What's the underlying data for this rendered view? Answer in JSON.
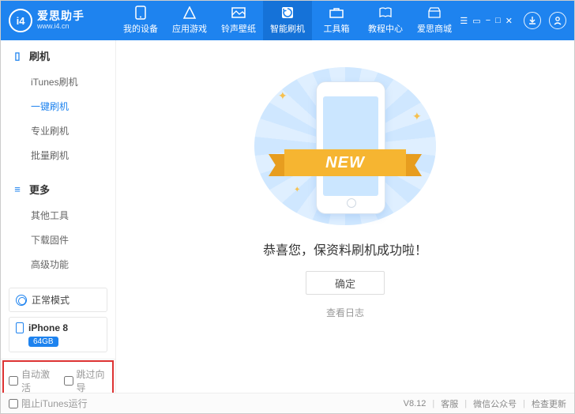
{
  "brand": {
    "name": "爱思助手",
    "url": "www.i4.cn",
    "logo_text": "i4"
  },
  "tabs": [
    {
      "label": "我的设备"
    },
    {
      "label": "应用游戏"
    },
    {
      "label": "铃声壁纸"
    },
    {
      "label": "智能刷机"
    },
    {
      "label": "工具箱"
    },
    {
      "label": "教程中心"
    },
    {
      "label": "爱思商城"
    }
  ],
  "active_tab_index": 3,
  "sidebar": {
    "group1": {
      "title": "刷机",
      "items": [
        "iTunes刷机",
        "一键刷机",
        "专业刷机",
        "批量刷机"
      ],
      "active_index": 1
    },
    "group2": {
      "title": "更多",
      "items": [
        "其他工具",
        "下载固件",
        "高级功能"
      ]
    },
    "mode": "正常模式",
    "device": {
      "name": "iPhone 8",
      "capacity": "64GB"
    },
    "cb1": "自动激活",
    "cb2": "跳过向导"
  },
  "main": {
    "ribbon_text": "NEW",
    "heading": "恭喜您，保资料刷机成功啦！",
    "ok_button": "确定",
    "view_log": "查看日志"
  },
  "footer": {
    "block_itunes": "阻止iTunes运行",
    "version": "V8.12",
    "support": "客服",
    "wechat": "微信公众号",
    "update": "检查更新"
  }
}
